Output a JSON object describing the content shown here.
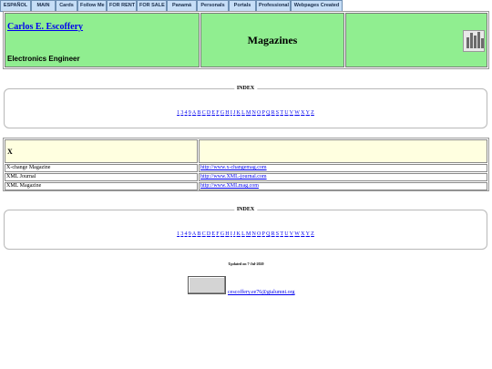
{
  "nav": [
    {
      "label": "ESPAÑOL"
    },
    {
      "label": "MAIN"
    },
    {
      "label": "Cards"
    },
    {
      "label": "Follow Me"
    },
    {
      "label": "FOR RENT"
    },
    {
      "label": "FOR SALE"
    },
    {
      "label": "Panamá"
    },
    {
      "label": "Personals"
    },
    {
      "label": "Portals"
    },
    {
      "label": "Professional"
    },
    {
      "label": "Webpages Created"
    }
  ],
  "header": {
    "author_name": "Carlos E. Escoffery",
    "author_role": "Electronics Engineer",
    "page_title": "Magazines"
  },
  "index": {
    "legend": "INDEX",
    "links": [
      "1",
      "3",
      "4",
      "9",
      "A",
      "B",
      "C",
      "D",
      "E",
      "F",
      "G",
      "H",
      "I",
      "J",
      "K",
      "L",
      "M",
      "N",
      "O",
      "P",
      "Q",
      "R",
      "S",
      "T",
      "U",
      "V",
      "W",
      "X",
      "Y",
      "Z"
    ]
  },
  "section": {
    "letter": "X",
    "magazines": [
      {
        "name": "X-change Magazine",
        "url": "http://www.x-changemag.com"
      },
      {
        "name": "XML Journal",
        "url": "http://www.XML-journal.com"
      },
      {
        "name": "XML Magazine",
        "url": "http://www.XMLmag.com"
      }
    ]
  },
  "footer": {
    "updated": "Updated on 7-Jul-2020",
    "email": "cescoffery.ee76@gtalumni.org"
  },
  "colors": {
    "header_green": "#90ee90",
    "letter_row_yellow": "#ffffe0",
    "nav_blue": "#c6def7",
    "link_blue": "#0000ee"
  }
}
